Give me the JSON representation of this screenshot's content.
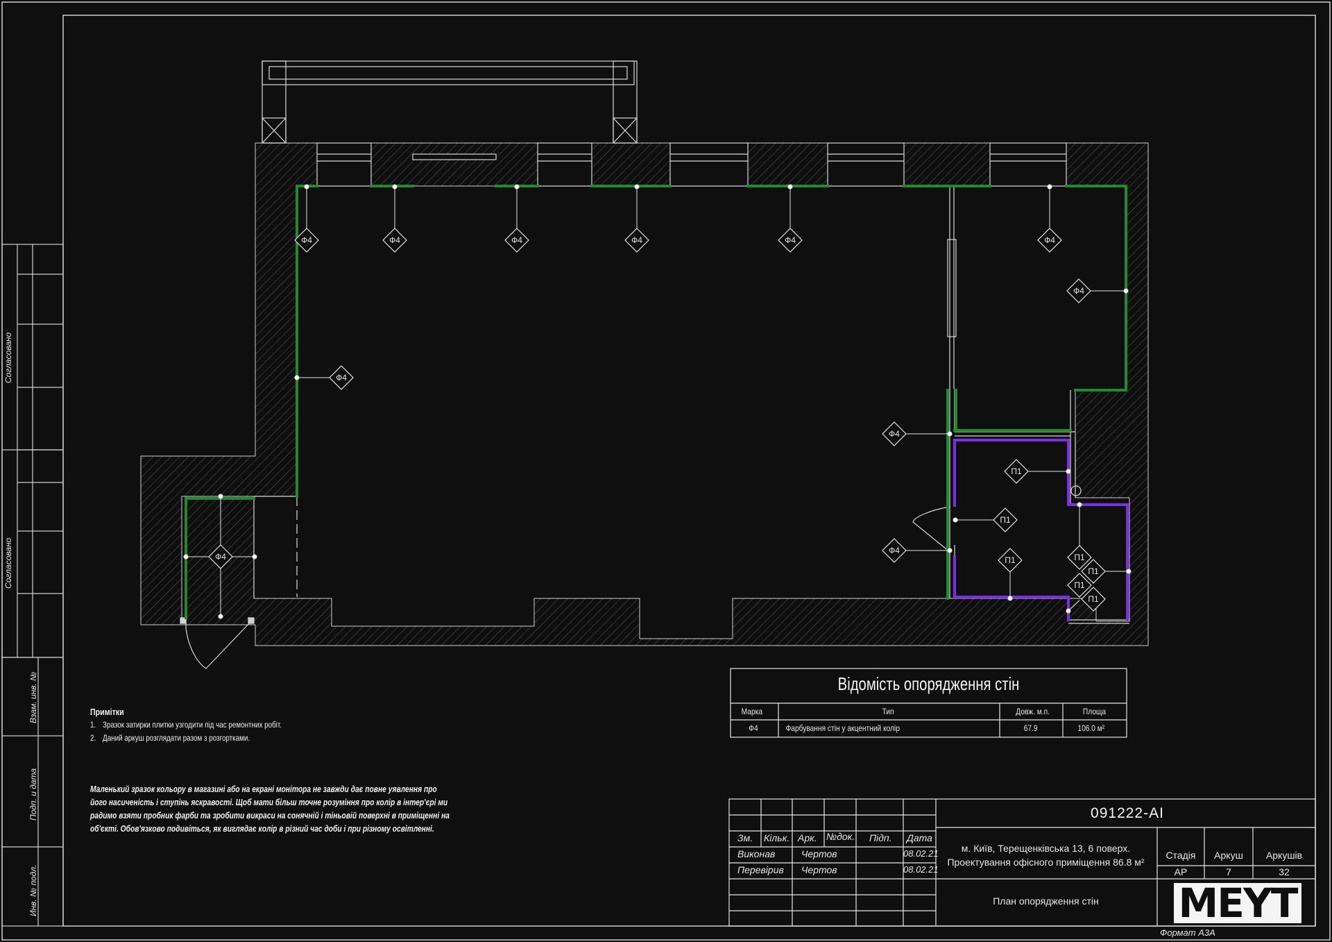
{
  "finish_mark": "Ф4",
  "tile_mark": "П1",
  "notes": {
    "title": "Примітки",
    "items": [
      {
        "n": "1.",
        "text": "Зразок затирки плитки узгодити під час ремонтних робіт."
      },
      {
        "n": "2.",
        "text": "Даний аркуш розглядати разом з розгортками."
      }
    ]
  },
  "disclaimer": "Маленький зразок кольору в магазині або на екрані монітора не завжди дає повне уявлення про його насиченість і ступінь яскравості. Щоб мати більш точне розуміння про колір в інтер'єрі  ми радимо взяти пробник фарби та зробити викраси на сонячній і тіньовій поверхні в приміщенні на об'єкті. Обов'язково подивіться, як виглядає колір в різний час доби і при різному освітленні.",
  "schedule": {
    "title": "Відомість опорядження стін",
    "headers": {
      "mark": "Марка",
      "type": "Тип",
      "length": "Довж. м.п.",
      "area": "Площа"
    },
    "rows": [
      {
        "mark": "Ф4",
        "type": "Фарбування стін у акцентний колір",
        "length": "67.9",
        "area": "106.0 м²"
      }
    ]
  },
  "title_block": {
    "code": "091222-АІ",
    "headers": {
      "zm": "Зм.",
      "kilk": "Кільк.",
      "ark": "Арк.",
      "ndok": "№док.",
      "pidp": "Підп.",
      "data": "Дата"
    },
    "rows": [
      {
        "role": "Виконав",
        "name": "Чертов",
        "date": "08.02.21"
      },
      {
        "role": "Перевірив",
        "name": "Чертов",
        "date": "08.02.21"
      }
    ],
    "address_line1": "м. Київ, Терещенківська 13, 6 поверх.",
    "address_line2": "Проектування офісного приміщення 86.8 м²",
    "stage_label": "Стадія",
    "sheet_label": "Аркуш",
    "sheets_label": "Аркушів",
    "stage": "АР",
    "sheet": "7",
    "sheets": "32",
    "plan_name": "План опорядження стін",
    "logo": "MEYT",
    "format": "Формат А3А"
  },
  "side_stamps": {
    "agreed_1": "Согласовано",
    "agreed_2": "Согласовано",
    "inv_replace": "Взам. инв. №",
    "sign_date": "Подп. и дата",
    "inv_orig": "Инв. № подл."
  },
  "colors": {
    "background": "#0f0f0f",
    "lines": "#d9d9d9",
    "paint_finish": "#1f8a2e",
    "tile_finish": "#7b2ee6"
  }
}
